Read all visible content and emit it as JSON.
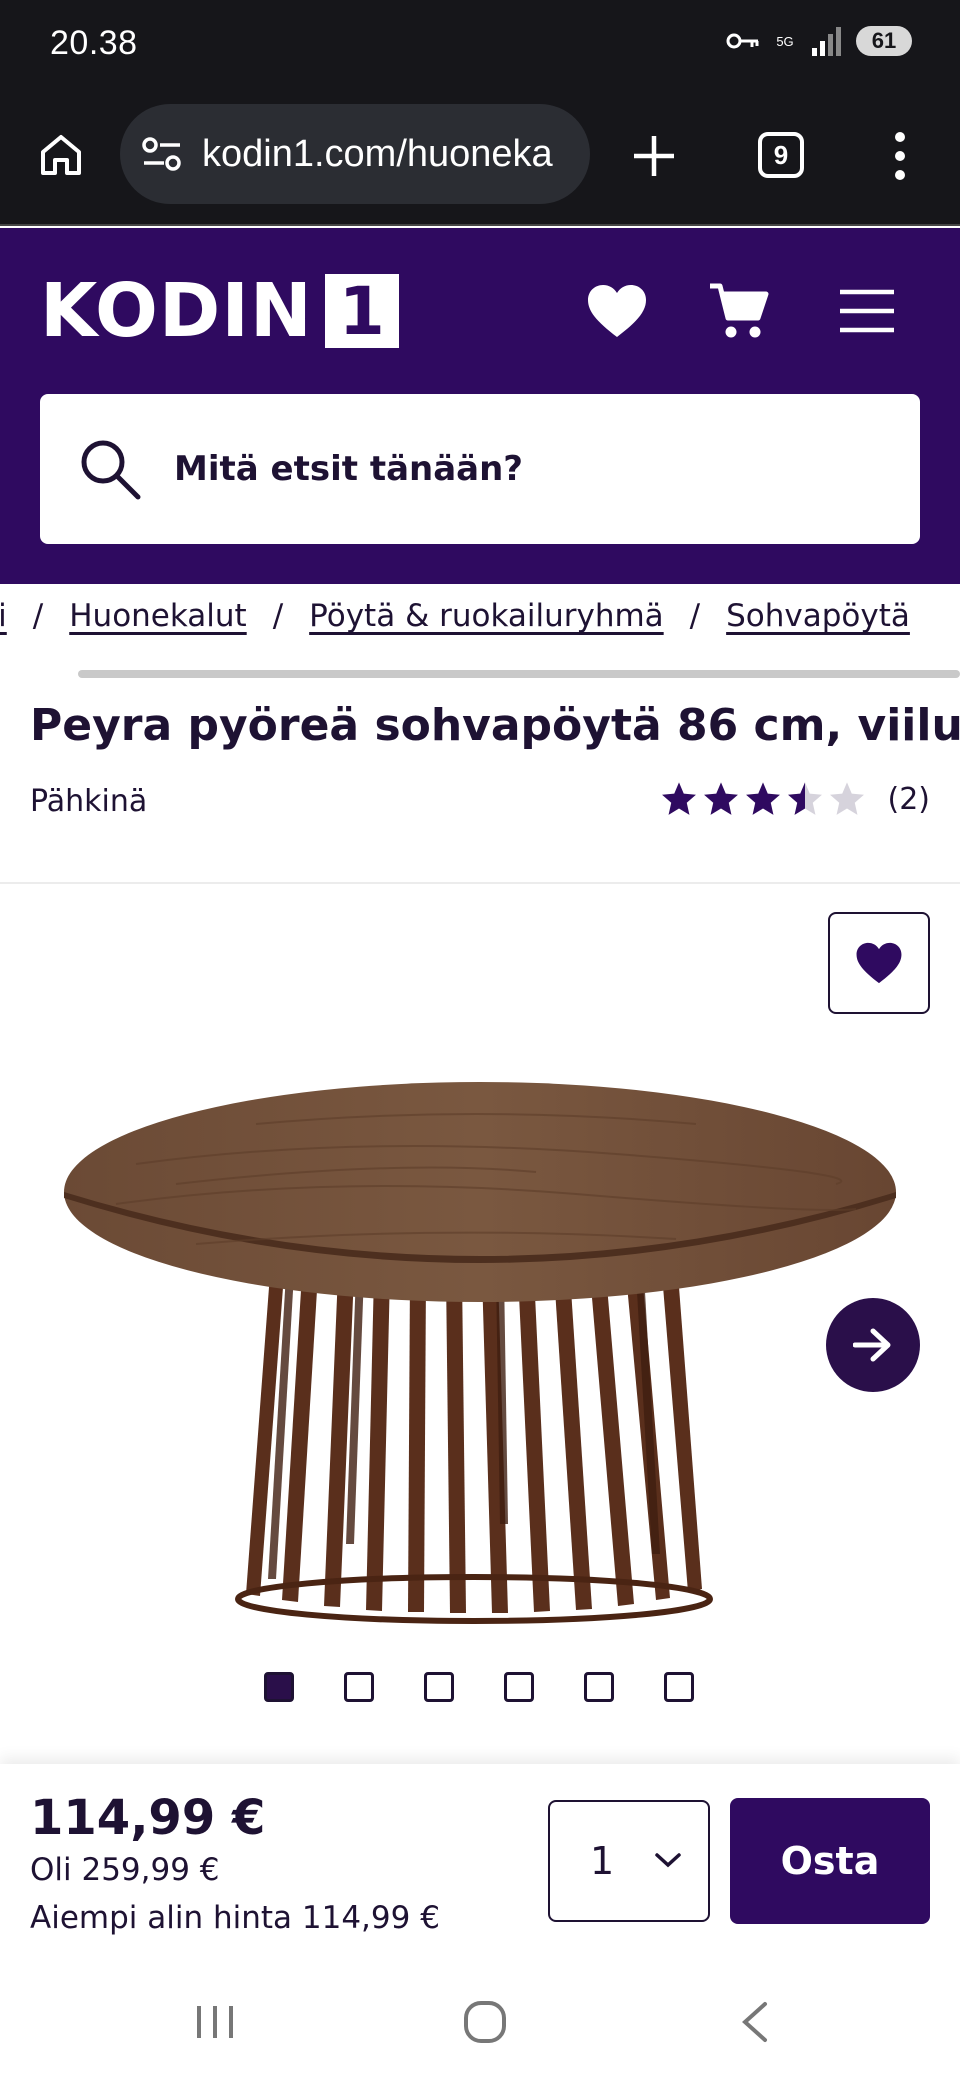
{
  "status_bar": {
    "time": "20.38",
    "network": "5G",
    "battery": "61"
  },
  "browser": {
    "url": "kodin1.com/huoneka",
    "tab_count": "9"
  },
  "site": {
    "logo_text": "KODIN",
    "logo_number": "1",
    "brand_color": "#2f0a60",
    "search_placeholder": "Mitä etsit tänään?"
  },
  "breadcrumb": {
    "partial_first": "ti",
    "items": [
      "Huonekalut",
      "Pöytä & ruokailuryhmä",
      "Sohvapöytä"
    ],
    "separator": "/"
  },
  "product": {
    "title": "Peyra pyöreä sohvapöytä 86 cm, viilu",
    "variant": "Pähkinä",
    "rating_value": 3.5,
    "rating_max": 5,
    "review_count": "(2)",
    "image_count": 6,
    "active_image_index": 0
  },
  "buy_bar": {
    "price": "114,99 €",
    "old_price": "Oli 259,99 €",
    "lowest_price": "Aiempi alin hinta 114,99 €",
    "quantity": "1",
    "buy_label": "Osta"
  }
}
